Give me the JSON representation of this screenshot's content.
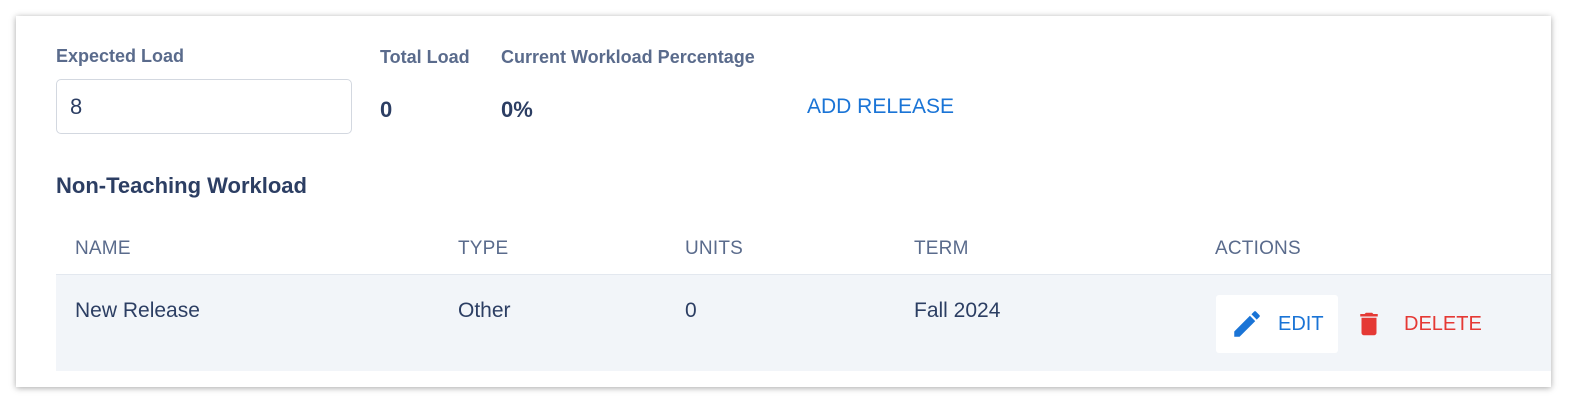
{
  "summary": {
    "expected_load_label": "Expected Load",
    "expected_load_value": "8",
    "total_load_label": "Total Load",
    "total_load_value": "0",
    "workload_pct_label": "Current Workload Percentage",
    "workload_pct_value": "0%",
    "add_release_label": "ADD RELEASE"
  },
  "section": {
    "title": "Non-Teaching Workload"
  },
  "table": {
    "headers": [
      "NAME",
      "TYPE",
      "UNITS",
      "TERM",
      "ACTIONS"
    ],
    "rows": [
      {
        "name": "New Release",
        "type": "Other",
        "units": "0",
        "term": "Fall 2024",
        "edit_label": "EDIT",
        "delete_label": "DELETE"
      }
    ]
  },
  "icons": {
    "edit": "pencil-icon",
    "delete": "trash-icon"
  },
  "colors": {
    "accent": "#1a74d6",
    "danger": "#e53935",
    "text": "#2c3e63",
    "muted": "#5a6b8c",
    "row_bg": "#f2f5f9"
  }
}
